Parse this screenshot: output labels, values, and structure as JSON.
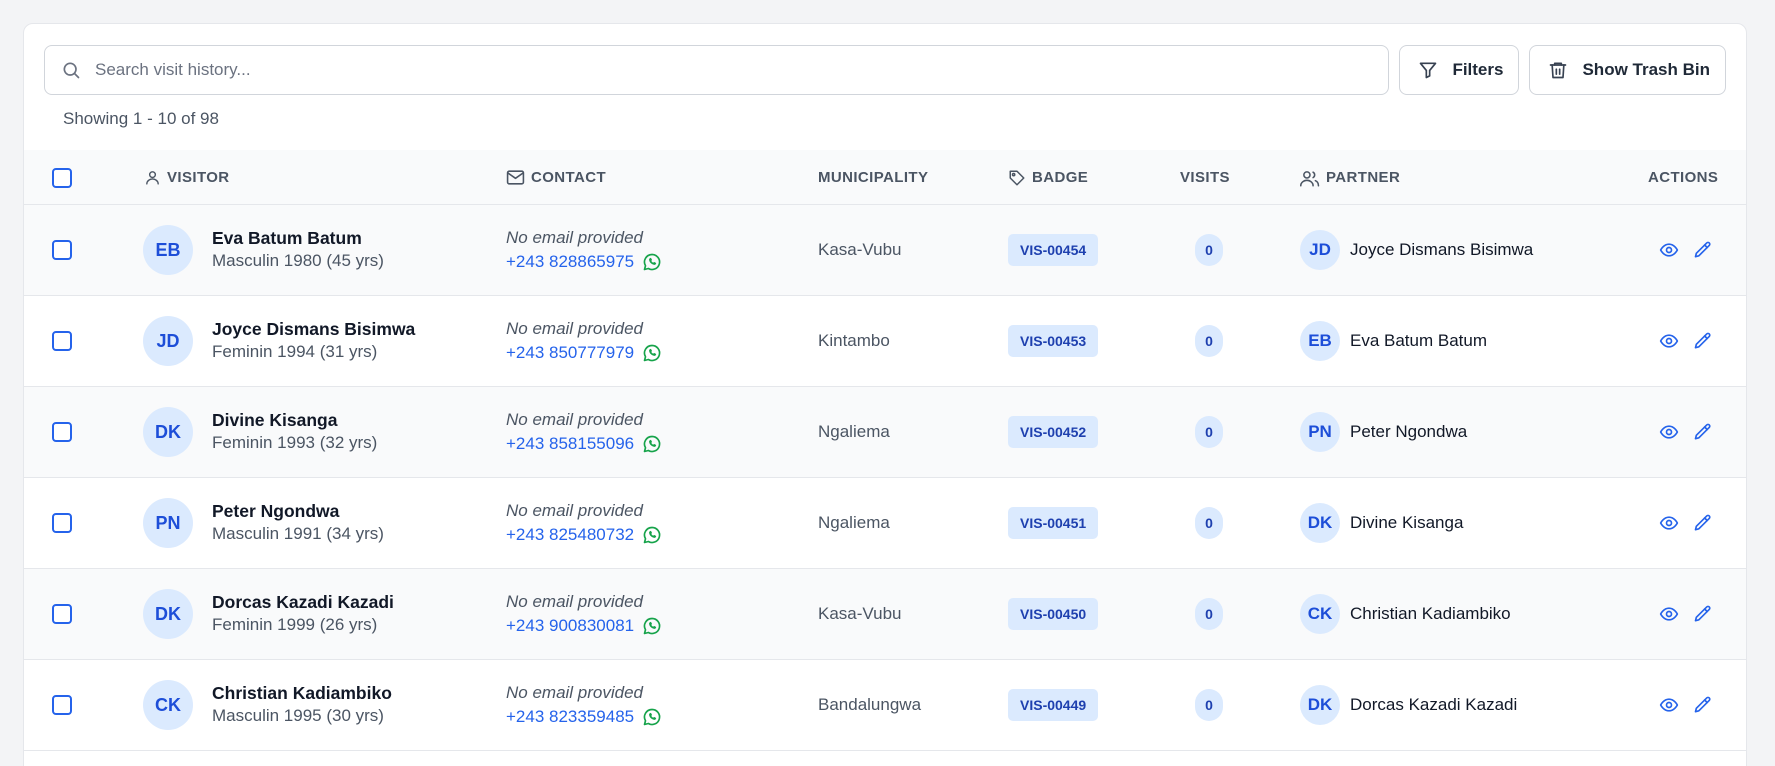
{
  "search": {
    "placeholder": "Search visit history..."
  },
  "toolbar": {
    "filters_label": "Filters",
    "trash_label": "Show Trash Bin"
  },
  "pagination": {
    "showing_text": "Showing 1 - 10 of 98"
  },
  "table": {
    "headers": {
      "visitor": "VISITOR",
      "contact": "CONTACT",
      "municipality": "MUNICIPALITY",
      "badge": "BADGE",
      "visits": "VISITS",
      "partner": "PARTNER",
      "actions": "ACTIONS"
    },
    "rows": [
      {
        "initials": "EB",
        "name": "Eva Batum Batum",
        "details": "Masculin 1980 (45 yrs)",
        "email": "No email provided",
        "phone": "+243 828865975",
        "municipality": "Kasa-Vubu",
        "badge": "VIS-00454",
        "visits": "0",
        "partner_initials": "JD",
        "partner_name": "Joyce Dismans Bisimwa"
      },
      {
        "initials": "JD",
        "name": "Joyce Dismans Bisimwa",
        "details": "Feminin 1994 (31 yrs)",
        "email": "No email provided",
        "phone": "+243 850777979",
        "municipality": "Kintambo",
        "badge": "VIS-00453",
        "visits": "0",
        "partner_initials": "EB",
        "partner_name": "Eva Batum Batum"
      },
      {
        "initials": "DK",
        "name": "Divine Kisanga",
        "details": "Feminin 1993 (32 yrs)",
        "email": "No email provided",
        "phone": "+243 858155096",
        "municipality": "Ngaliema",
        "badge": "VIS-00452",
        "visits": "0",
        "partner_initials": "PN",
        "partner_name": "Peter Ngondwa"
      },
      {
        "initials": "PN",
        "name": "Peter Ngondwa",
        "details": "Masculin 1991 (34 yrs)",
        "email": "No email provided",
        "phone": "+243 825480732",
        "municipality": "Ngaliema",
        "badge": "VIS-00451",
        "visits": "0",
        "partner_initials": "DK",
        "partner_name": "Divine Kisanga"
      },
      {
        "initials": "DK",
        "name": "Dorcas Kazadi Kazadi",
        "details": "Feminin 1999 (26 yrs)",
        "email": "No email provided",
        "phone": "+243 900830081",
        "municipality": "Kasa-Vubu",
        "badge": "VIS-00450",
        "visits": "0",
        "partner_initials": "CK",
        "partner_name": "Christian Kadiambiko"
      },
      {
        "initials": "CK",
        "name": "Christian Kadiambiko",
        "details": "Masculin 1995 (30 yrs)",
        "email": "No email provided",
        "phone": "+243 823359485",
        "municipality": "Bandalungwa",
        "badge": "VIS-00449",
        "visits": "0",
        "partner_initials": "DK",
        "partner_name": "Dorcas Kazadi Kazadi"
      }
    ]
  },
  "icons": {
    "search": "search-icon",
    "filter": "filter-icon",
    "trash": "trash-icon",
    "user": "user-icon",
    "mail": "mail-icon",
    "tag": "tag-icon",
    "users": "users-icon",
    "whatsapp": "whatsapp-icon",
    "view": "eye-icon",
    "edit": "pencil-icon"
  },
  "colors": {
    "accent": "#2563eb",
    "badge_bg": "#dbeafe",
    "badge_text": "#1e40af",
    "whatsapp": "#16a34a"
  }
}
